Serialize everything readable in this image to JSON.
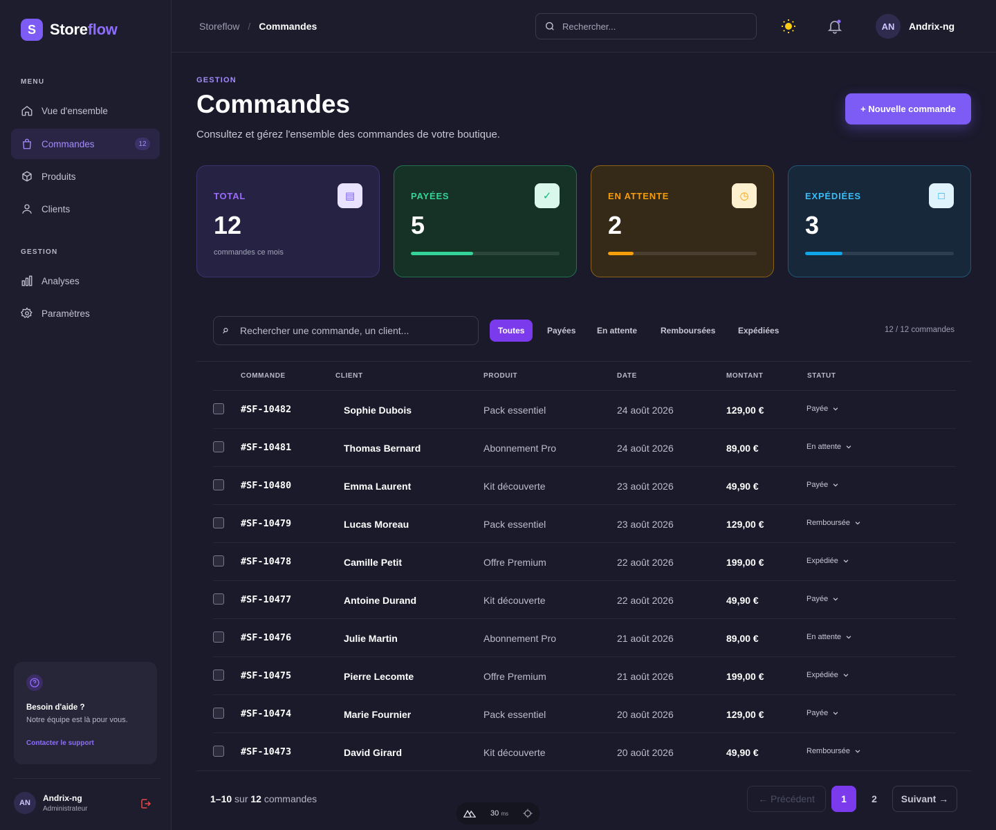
{
  "app": {
    "logo_letter": "S",
    "name_part1": "Store",
    "name_part2": "flow"
  },
  "sidebar": {
    "menu_heading": "MENU",
    "gestion_heading": "GESTION",
    "items": [
      {
        "label": "Vue d'ensemble",
        "icon": "home-icon"
      },
      {
        "label": "Commandes",
        "icon": "shopping-bag-icon",
        "badge": "12",
        "active": true
      },
      {
        "label": "Produits",
        "icon": "box-icon"
      },
      {
        "label": "Clients",
        "icon": "users-icon"
      },
      {
        "label": "Analyses",
        "icon": "bar-chart-icon"
      },
      {
        "label": "Paramètres",
        "icon": "gear-icon"
      }
    ],
    "help": {
      "title": "Besoin d'aide ?",
      "text": "Notre équipe est là pour vous.",
      "link": "Contacter le support"
    },
    "user": {
      "initials": "AN",
      "name": "Andrix-ng",
      "role": "Administrateur"
    }
  },
  "topbar": {
    "breadcrumb": [
      "Storeflow",
      "Commandes"
    ],
    "breadcrumb_sep": "/",
    "search_placeholder": "Rechercher...",
    "user_initials": "AN",
    "user_name": "Andrix-ng"
  },
  "header": {
    "eyebrow": "GESTION",
    "title": "Commandes",
    "subtitle": "Consultez et gérez l'ensemble des commandes de votre boutique.",
    "new_button": "+ Nouvelle commande"
  },
  "stats": [
    {
      "label": "TOTAL",
      "value": "12",
      "note": "commandes ce mois",
      "icon": "list-icon",
      "glyph": "▤",
      "color": "#9b6cff"
    },
    {
      "label": "PAYÉES",
      "value": "5",
      "progress": 0.42,
      "icon": "check-icon",
      "glyph": "✓",
      "color": "#34d399"
    },
    {
      "label": "EN ATTENTE",
      "value": "2",
      "progress": 0.17,
      "icon": "clock-icon",
      "glyph": "◷",
      "color": "#f59e0b"
    },
    {
      "label": "EXPÉDIÉES",
      "value": "3",
      "progress": 0.25,
      "icon": "package-icon",
      "glyph": "□",
      "color": "#38bdf8"
    }
  ],
  "filters": {
    "search_placeholder": "Rechercher une commande, un client...",
    "chips": [
      "Toutes",
      "Payées",
      "En attente",
      "Remboursées",
      "Expédiées"
    ],
    "active_chip": "Toutes",
    "count": "12 / 12 commandes"
  },
  "table": {
    "headers": [
      "COMMANDE",
      "CLIENT",
      "PRODUIT",
      "DATE",
      "MONTANT",
      "STATUT"
    ],
    "rows": [
      {
        "id": "#SF-10482",
        "client": "Sophie Dubois",
        "product": "Pack essentiel",
        "date": "24 août 2026",
        "amount": "129,00 €",
        "status": "Payée"
      },
      {
        "id": "#SF-10481",
        "client": "Thomas Bernard",
        "product": "Abonnement Pro",
        "date": "24 août 2026",
        "amount": "89,00 €",
        "status": "En attente"
      },
      {
        "id": "#SF-10480",
        "client": "Emma Laurent",
        "product": "Kit découverte",
        "date": "23 août 2026",
        "amount": "49,90 €",
        "status": "Payée"
      },
      {
        "id": "#SF-10479",
        "client": "Lucas Moreau",
        "product": "Pack essentiel",
        "date": "23 août 2026",
        "amount": "129,00 €",
        "status": "Remboursée"
      },
      {
        "id": "#SF-10478",
        "client": "Camille Petit",
        "product": "Offre Premium",
        "date": "22 août 2026",
        "amount": "199,00 €",
        "status": "Expédiée"
      },
      {
        "id": "#SF-10477",
        "client": "Antoine Durand",
        "product": "Kit découverte",
        "date": "22 août 2026",
        "amount": "49,90 €",
        "status": "Payée"
      },
      {
        "id": "#SF-10476",
        "client": "Julie Martin",
        "product": "Abonnement Pro",
        "date": "21 août 2026",
        "amount": "89,00 €",
        "status": "En attente"
      },
      {
        "id": "#SF-10475",
        "client": "Pierre Lecomte",
        "product": "Offre Premium",
        "date": "21 août 2026",
        "amount": "199,00 €",
        "status": "Expédiée"
      },
      {
        "id": "#SF-10474",
        "client": "Marie Fournier",
        "product": "Pack essentiel",
        "date": "20 août 2026",
        "amount": "129,00 €",
        "status": "Payée"
      },
      {
        "id": "#SF-10473",
        "client": "David Girard",
        "product": "Kit découverte",
        "date": "20 août 2026",
        "amount": "49,90 €",
        "status": "Remboursée"
      }
    ]
  },
  "pagination": {
    "range": "1–10",
    "word_on": "sur",
    "total": "12",
    "word_items": "commandes",
    "prev": "← Précédent",
    "next": "Suivant →",
    "pages": [
      "1",
      "2"
    ],
    "current": "1"
  },
  "devbar": {
    "value": "30",
    "unit": "ms"
  }
}
